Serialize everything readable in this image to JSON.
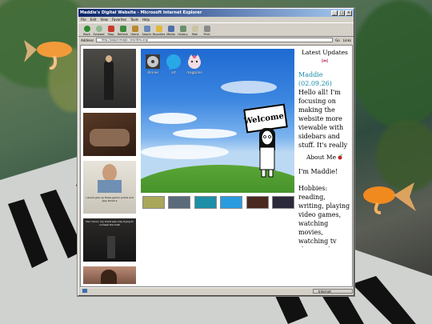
{
  "window": {
    "title": "Maddie's Digital Website - Microsoft Internet Explorer",
    "menu": [
      "File",
      "Edit",
      "View",
      "Favorites",
      "Tools",
      "Help"
    ],
    "toolbar": [
      "Back",
      "Forward",
      "Stop",
      "Refresh",
      "Home",
      "Search",
      "Favorites",
      "Media",
      "History",
      "Mail",
      "Print"
    ],
    "address_label": "Address",
    "url": "http://poppinmagic.neocities.org/",
    "go_label": "Go",
    "links_label": "Links",
    "status_zone": "Internet"
  },
  "desktop_icons": [
    {
      "label": "shrines",
      "icon": "cd-icon"
    },
    {
      "label": "art",
      "icon": "paint-blob-icon"
    },
    {
      "label": "magazine",
      "icon": "cat-face-icon"
    }
  ],
  "welcome_sign": "Welcome!",
  "photo_captions": [
    "",
    "",
    "I would give up these gamer points and play Portal 2",
    "Your honor, my client was only trying to unmask the truth",
    ""
  ],
  "sidebar": {
    "updates_title": "Latest Updates",
    "update_author": "Maddie",
    "update_date": "(02.09.26)",
    "update_text": "Hello all! I'm focusing on making the website more viewable with sidebars and stuff. It's really",
    "about_title": "About Me",
    "about_paragraphs": [
      "I'm Maddie!",
      "Hobbies: reading, writing, playing video games, watching movies, watching tv shows, editing"
    ]
  }
}
